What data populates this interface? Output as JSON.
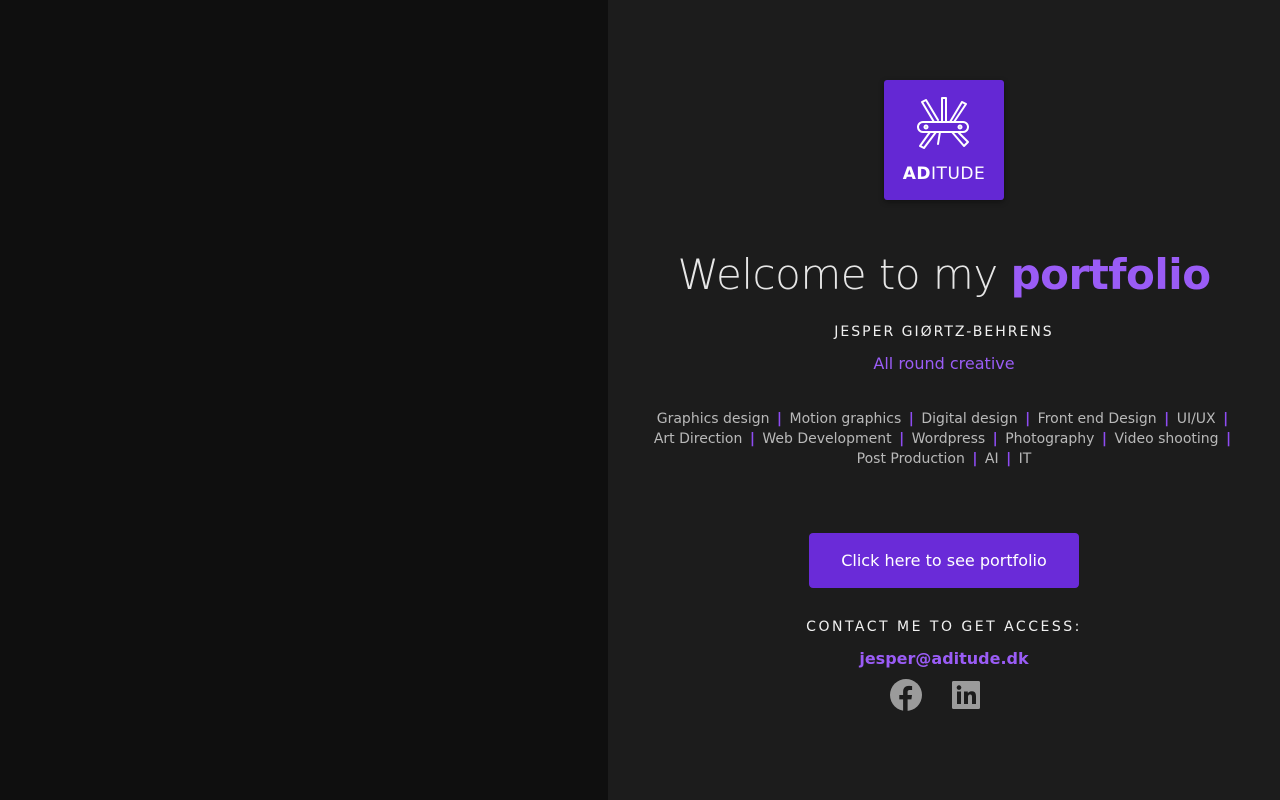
{
  "logo": {
    "text_bold": "AD",
    "text_light": "ITUDE",
    "icon": "multitool-icon",
    "background": "#6428d4"
  },
  "hero": {
    "title_prefix": "Welcome to my ",
    "title_accent": "portfolio",
    "name": "JESPER GIØRTZ-BEHRENS",
    "tagline": "All round creative",
    "accent_color": "#9a5cf6"
  },
  "skills": [
    "Graphics design",
    "Motion graphics",
    "Digital design",
    "Front end Design",
    "UI/UX",
    "Art Direction",
    "Web Development",
    "Wordpress",
    "Photography",
    "Video shooting",
    "Post Production",
    "AI",
    "IT"
  ],
  "skills_separator": "|",
  "cta": {
    "label": "Click here to see portfolio"
  },
  "contact": {
    "label": "CONTACT ME TO GET ACCESS:",
    "email": "jesper@aditude.dk"
  },
  "socials": [
    {
      "icon": "facebook-icon"
    },
    {
      "icon": "linkedin-icon"
    }
  ]
}
